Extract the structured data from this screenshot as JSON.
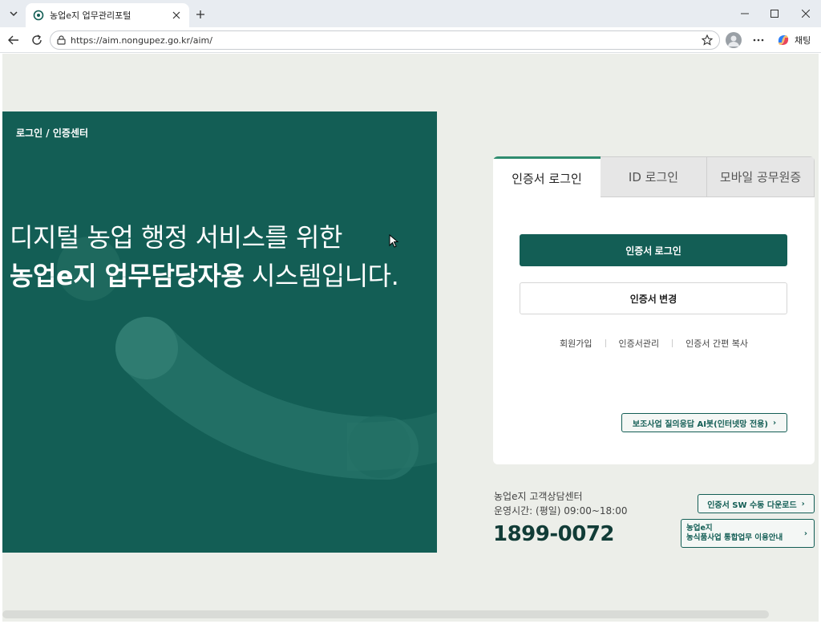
{
  "browser": {
    "tab_title": "농업e지 업무관리포털",
    "url": "https://aim.nongupez.go.kr/aim/",
    "copilot_label": "채팅"
  },
  "hero": {
    "breadcrumb": "로그인 / 인증센터",
    "line1": "디지털 농업 행정 서비스를 위한",
    "line2_bold": "농업e지 업무담당자용",
    "line2_rest": " 시스템입니다."
  },
  "login": {
    "tabs": [
      {
        "label": "인증서 로그인",
        "active": true
      },
      {
        "label": "ID 로그인",
        "active": false
      },
      {
        "label": "모바일 공무원증",
        "active": false
      }
    ],
    "primary_button": "인증서 로그인",
    "secondary_button": "인증서 변경",
    "links": [
      "회원가입",
      "인증서관리",
      "인증서 간편 복사"
    ],
    "ai_button": "보조사업 질의응답 AI봇(인터넷망 전용)"
  },
  "customer_center": {
    "title": "농업e지 고객상담센터",
    "hours": "운영시간: (평일) 09:00~18:00",
    "phone": "1899-0072",
    "download_button": "인증서 SW 수동 다운로드",
    "guide_line1": "농업e지",
    "guide_line2": "농식품사업 통합업무 이용안내"
  },
  "colors": {
    "brand": "#135e55",
    "accent": "#2f8c6f",
    "page_bg": "#eceee9"
  }
}
